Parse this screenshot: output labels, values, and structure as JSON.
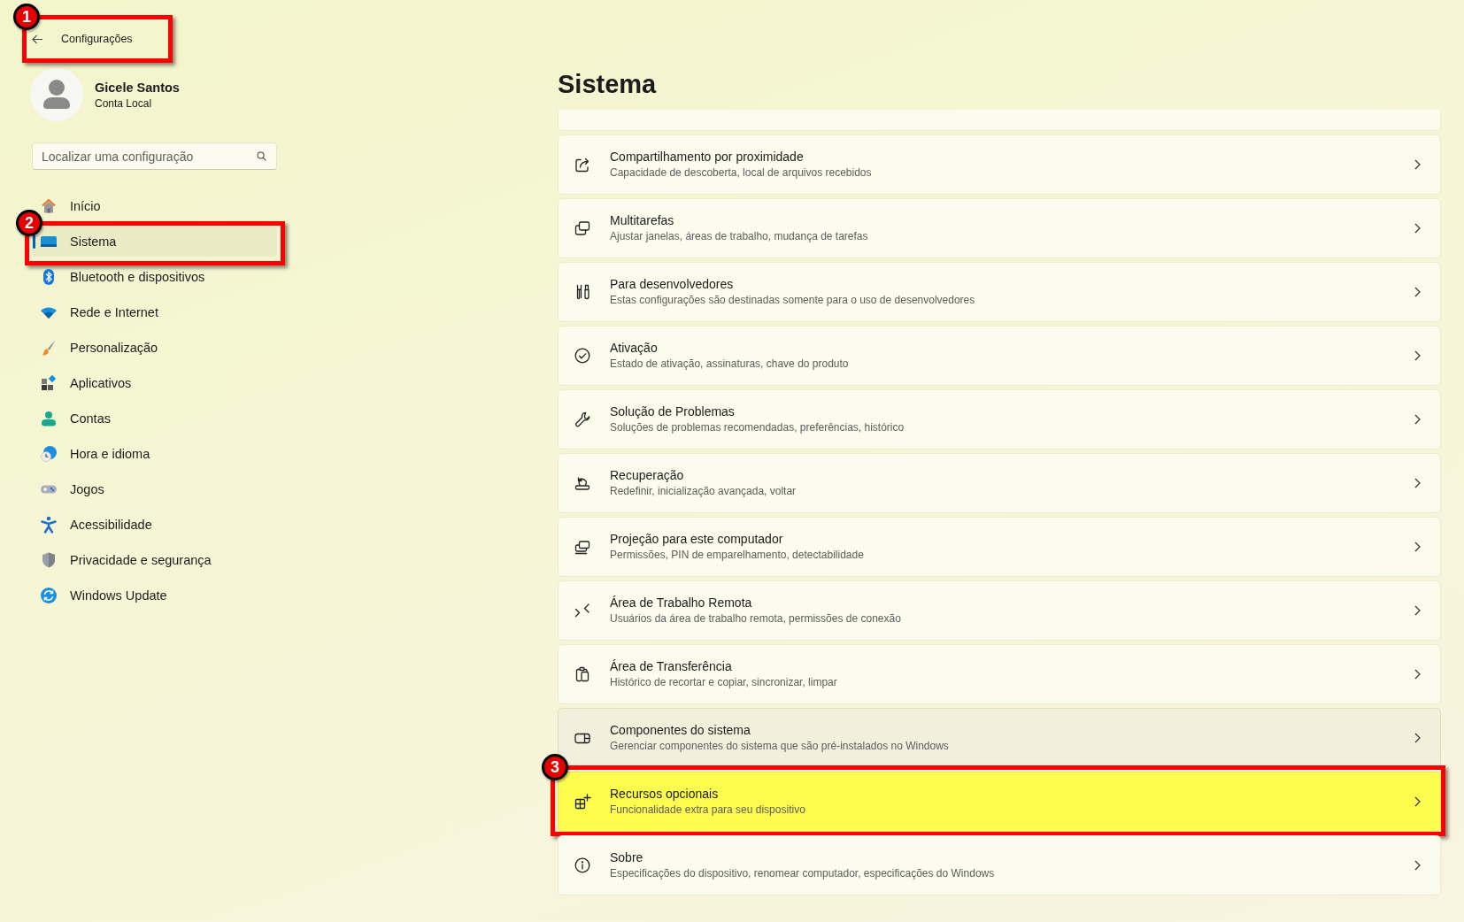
{
  "header": {
    "title": "Configurações",
    "callout": "1"
  },
  "profile": {
    "name": "Gicele Santos",
    "account": "Conta Local"
  },
  "search": {
    "placeholder": "Localizar uma configuração"
  },
  "nav": [
    {
      "label": "Início",
      "selected": false
    },
    {
      "label": "Sistema",
      "selected": true,
      "callout": "2"
    },
    {
      "label": "Bluetooth e dispositivos",
      "selected": false
    },
    {
      "label": "Rede e Internet",
      "selected": false
    },
    {
      "label": "Personalização",
      "selected": false
    },
    {
      "label": "Aplicativos",
      "selected": false
    },
    {
      "label": "Contas",
      "selected": false
    },
    {
      "label": "Hora e idioma",
      "selected": false
    },
    {
      "label": "Jogos",
      "selected": false
    },
    {
      "label": "Acessibilidade",
      "selected": false
    },
    {
      "label": "Privacidade e segurança",
      "selected": false
    },
    {
      "label": "Windows Update",
      "selected": false
    }
  ],
  "page": {
    "title": "Sistema"
  },
  "rows": [
    {
      "title": "Compartilhamento por proximidade",
      "subtitle": "Capacidade de descoberta, local de arquivos recebidos",
      "hovered": false,
      "highlighted": false
    },
    {
      "title": "Multitarefas",
      "subtitle": "Ajustar janelas, áreas de trabalho, mudança de tarefas",
      "hovered": false,
      "highlighted": false
    },
    {
      "title": "Para desenvolvedores",
      "subtitle": "Estas configurações são destinadas somente para o uso de desenvolvedores",
      "hovered": false,
      "highlighted": false
    },
    {
      "title": "Ativação",
      "subtitle": "Estado de ativação, assinaturas, chave do produto",
      "hovered": false,
      "highlighted": false
    },
    {
      "title": "Solução de Problemas",
      "subtitle": "Soluções de problemas recomendadas, preferências, histórico",
      "hovered": false,
      "highlighted": false
    },
    {
      "title": "Recuperação",
      "subtitle": "Redefinir, inicialização avançada, voltar",
      "hovered": false,
      "highlighted": false
    },
    {
      "title": "Projeção para este computador",
      "subtitle": "Permissões, PIN de emparelhamento, detectabilidade",
      "hovered": false,
      "highlighted": false
    },
    {
      "title": "Área de Trabalho Remota",
      "subtitle": "Usuários da área de trabalho remota, permissões de conexão",
      "hovered": false,
      "highlighted": false
    },
    {
      "title": "Área de Transferência",
      "subtitle": "Histórico de recortar e copiar, sincronizar, limpar",
      "hovered": false,
      "highlighted": false
    },
    {
      "title": "Componentes do sistema",
      "subtitle": "Gerenciar componentes do sistema que são pré-instalados no Windows",
      "hovered": true,
      "highlighted": false
    },
    {
      "title": "Recursos opcionais",
      "subtitle": "Funcionalidade extra para seu dispositivo",
      "hovered": false,
      "highlighted": true,
      "callout": "3"
    },
    {
      "title": "Sobre",
      "subtitle": "Especificações do dispositivo, renomear computador, especificações do Windows",
      "hovered": false,
      "highlighted": false
    }
  ]
}
